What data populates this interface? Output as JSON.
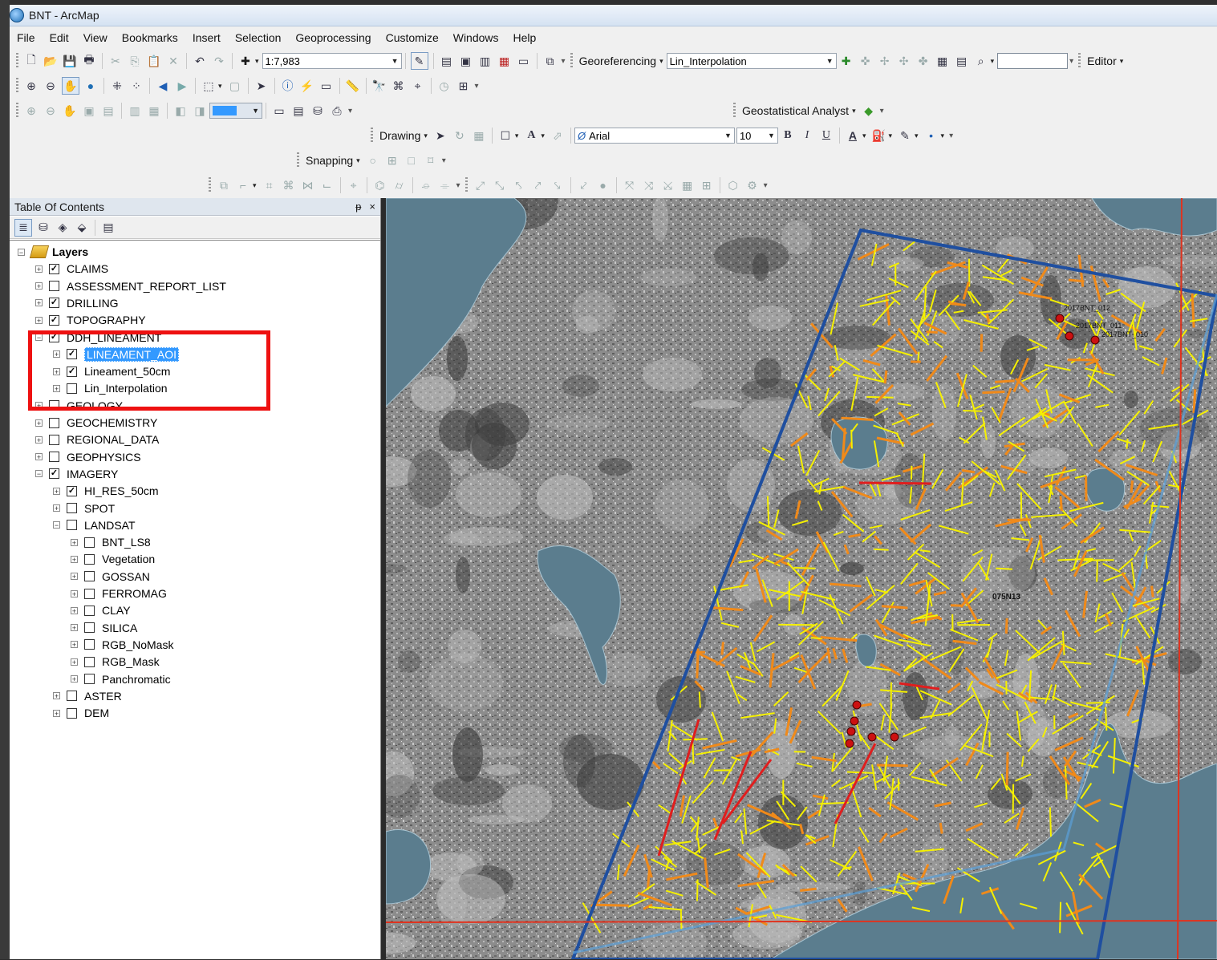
{
  "window": {
    "title": "BNT - ArcMap"
  },
  "menu": [
    "File",
    "Edit",
    "View",
    "Bookmarks",
    "Insert",
    "Selection",
    "Geoprocessing",
    "Customize",
    "Windows",
    "Help"
  ],
  "toolbar": {
    "scale": "1:7,983",
    "georeferencing_label": "Georeferencing",
    "georef_layer": "Lin_Interpolation",
    "editor_label": "Editor",
    "geostat_label": "Geostatistical Analyst",
    "drawing_label": "Drawing",
    "font_name": "Arial",
    "font_size": "10",
    "bold": "B",
    "italic": "I",
    "underline": "U",
    "font_color_label": "A",
    "snapping_label": "Snapping"
  },
  "toc": {
    "title": "Table Of Contents",
    "pin": "ᵽ",
    "close": "×",
    "items": [
      {
        "label": "Layers",
        "checked": null,
        "expanded": true
      },
      {
        "label": "CLAIMS",
        "checked": true
      },
      {
        "label": "ASSESSMENT_REPORT_LIST",
        "checked": false
      },
      {
        "label": "DRILLING",
        "checked": true
      },
      {
        "label": "TOPOGRAPHY",
        "checked": true
      },
      {
        "label": "DDH_LINEAMENT",
        "checked": true,
        "expanded": true
      },
      {
        "label": "LINEAMENT_AOI",
        "checked": true,
        "selected": true
      },
      {
        "label": "Lineament_50cm",
        "checked": true
      },
      {
        "label": "Lin_Interpolation",
        "checked": false
      },
      {
        "label": "GEOLOGY",
        "checked": false
      },
      {
        "label": "GEOCHEMISTRY",
        "checked": false
      },
      {
        "label": "REGIONAL_DATA",
        "checked": false
      },
      {
        "label": "GEOPHYSICS",
        "checked": false
      },
      {
        "label": "IMAGERY",
        "checked": true,
        "expanded": true
      },
      {
        "label": "HI_RES_50cm",
        "checked": true
      },
      {
        "label": "SPOT",
        "checked": false
      },
      {
        "label": "LANDSAT",
        "checked": false,
        "expanded": true
      },
      {
        "label": "BNT_LS8",
        "checked": false
      },
      {
        "label": "Vegetation",
        "checked": false
      },
      {
        "label": "GOSSAN",
        "checked": false
      },
      {
        "label": "FERROMAG",
        "checked": false
      },
      {
        "label": "CLAY",
        "checked": false
      },
      {
        "label": "SILICA",
        "checked": false
      },
      {
        "label": "RGB_NoMask",
        "checked": false
      },
      {
        "label": "RGB_Mask",
        "checked": false
      },
      {
        "label": "Panchromatic",
        "checked": false
      },
      {
        "label": "ASTER",
        "checked": false
      },
      {
        "label": "DEM",
        "checked": false
      }
    ]
  },
  "map": {
    "labels": [
      "2017BNT_012",
      "2017BNT_011",
      "2017BNT_010",
      "075N13"
    ],
    "colors": {
      "aoi_outline": "#1f4fa0",
      "grid_lines": "#e0331f",
      "lineament_yellow": "#f5f000",
      "lineament_orange": "#f08a1a",
      "lineament_red": "#e01e1e",
      "water": "#5b7d8e",
      "drillhole": "#cc1111"
    }
  }
}
